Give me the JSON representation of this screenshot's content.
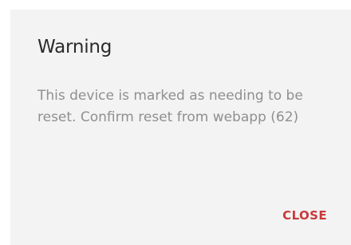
{
  "dialog": {
    "title": "Warning",
    "message": "This device is marked as needing to be reset. Confirm reset from webapp (62)",
    "close_label": "CLOSE"
  },
  "colors": {
    "dialog_background": "#f3f3f3",
    "title_text": "#2b2b2b",
    "message_text": "#8f8f8f",
    "accent": "#c83a3a"
  }
}
